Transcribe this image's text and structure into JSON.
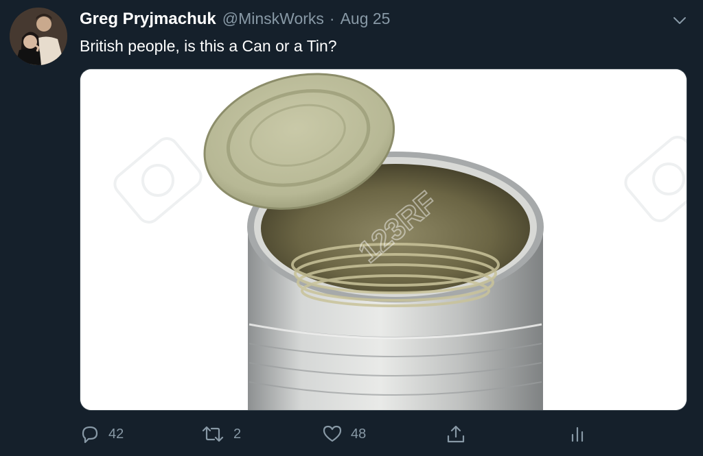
{
  "tweet": {
    "author_name": "Greg Pryjmachuk",
    "handle": "@MinskWorks",
    "separator": "·",
    "date": "Aug 25",
    "text": "British people, is this a Can or a Tin?"
  },
  "media": {
    "watermark_text": "123RF"
  },
  "actions": {
    "reply_count": "42",
    "retweet_count": "2",
    "like_count": "48"
  },
  "icons": {
    "menu": "chevron-down-icon",
    "reply": "reply-icon",
    "retweet": "retweet-icon",
    "like": "heart-icon",
    "share": "share-icon",
    "analytics": "analytics-icon"
  },
  "colors": {
    "background": "#15202b",
    "secondary_text": "#8899a6",
    "border": "#38444d"
  }
}
